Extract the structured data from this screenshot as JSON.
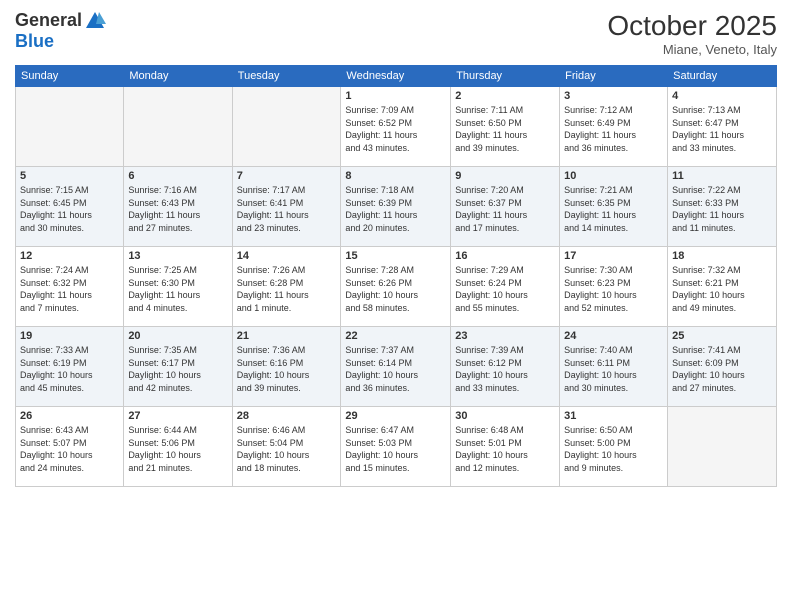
{
  "header": {
    "logo_line1": "General",
    "logo_line2": "Blue",
    "month_title": "October 2025",
    "location": "Miane, Veneto, Italy"
  },
  "days_of_week": [
    "Sunday",
    "Monday",
    "Tuesday",
    "Wednesday",
    "Thursday",
    "Friday",
    "Saturday"
  ],
  "weeks": [
    [
      {
        "day": "",
        "info": ""
      },
      {
        "day": "",
        "info": ""
      },
      {
        "day": "",
        "info": ""
      },
      {
        "day": "1",
        "info": "Sunrise: 7:09 AM\nSunset: 6:52 PM\nDaylight: 11 hours\nand 43 minutes."
      },
      {
        "day": "2",
        "info": "Sunrise: 7:11 AM\nSunset: 6:50 PM\nDaylight: 11 hours\nand 39 minutes."
      },
      {
        "day": "3",
        "info": "Sunrise: 7:12 AM\nSunset: 6:49 PM\nDaylight: 11 hours\nand 36 minutes."
      },
      {
        "day": "4",
        "info": "Sunrise: 7:13 AM\nSunset: 6:47 PM\nDaylight: 11 hours\nand 33 minutes."
      }
    ],
    [
      {
        "day": "5",
        "info": "Sunrise: 7:15 AM\nSunset: 6:45 PM\nDaylight: 11 hours\nand 30 minutes."
      },
      {
        "day": "6",
        "info": "Sunrise: 7:16 AM\nSunset: 6:43 PM\nDaylight: 11 hours\nand 27 minutes."
      },
      {
        "day": "7",
        "info": "Sunrise: 7:17 AM\nSunset: 6:41 PM\nDaylight: 11 hours\nand 23 minutes."
      },
      {
        "day": "8",
        "info": "Sunrise: 7:18 AM\nSunset: 6:39 PM\nDaylight: 11 hours\nand 20 minutes."
      },
      {
        "day": "9",
        "info": "Sunrise: 7:20 AM\nSunset: 6:37 PM\nDaylight: 11 hours\nand 17 minutes."
      },
      {
        "day": "10",
        "info": "Sunrise: 7:21 AM\nSunset: 6:35 PM\nDaylight: 11 hours\nand 14 minutes."
      },
      {
        "day": "11",
        "info": "Sunrise: 7:22 AM\nSunset: 6:33 PM\nDaylight: 11 hours\nand 11 minutes."
      }
    ],
    [
      {
        "day": "12",
        "info": "Sunrise: 7:24 AM\nSunset: 6:32 PM\nDaylight: 11 hours\nand 7 minutes."
      },
      {
        "day": "13",
        "info": "Sunrise: 7:25 AM\nSunset: 6:30 PM\nDaylight: 11 hours\nand 4 minutes."
      },
      {
        "day": "14",
        "info": "Sunrise: 7:26 AM\nSunset: 6:28 PM\nDaylight: 11 hours\nand 1 minute."
      },
      {
        "day": "15",
        "info": "Sunrise: 7:28 AM\nSunset: 6:26 PM\nDaylight: 10 hours\nand 58 minutes."
      },
      {
        "day": "16",
        "info": "Sunrise: 7:29 AM\nSunset: 6:24 PM\nDaylight: 10 hours\nand 55 minutes."
      },
      {
        "day": "17",
        "info": "Sunrise: 7:30 AM\nSunset: 6:23 PM\nDaylight: 10 hours\nand 52 minutes."
      },
      {
        "day": "18",
        "info": "Sunrise: 7:32 AM\nSunset: 6:21 PM\nDaylight: 10 hours\nand 49 minutes."
      }
    ],
    [
      {
        "day": "19",
        "info": "Sunrise: 7:33 AM\nSunset: 6:19 PM\nDaylight: 10 hours\nand 45 minutes."
      },
      {
        "day": "20",
        "info": "Sunrise: 7:35 AM\nSunset: 6:17 PM\nDaylight: 10 hours\nand 42 minutes."
      },
      {
        "day": "21",
        "info": "Sunrise: 7:36 AM\nSunset: 6:16 PM\nDaylight: 10 hours\nand 39 minutes."
      },
      {
        "day": "22",
        "info": "Sunrise: 7:37 AM\nSunset: 6:14 PM\nDaylight: 10 hours\nand 36 minutes."
      },
      {
        "day": "23",
        "info": "Sunrise: 7:39 AM\nSunset: 6:12 PM\nDaylight: 10 hours\nand 33 minutes."
      },
      {
        "day": "24",
        "info": "Sunrise: 7:40 AM\nSunset: 6:11 PM\nDaylight: 10 hours\nand 30 minutes."
      },
      {
        "day": "25",
        "info": "Sunrise: 7:41 AM\nSunset: 6:09 PM\nDaylight: 10 hours\nand 27 minutes."
      }
    ],
    [
      {
        "day": "26",
        "info": "Sunrise: 6:43 AM\nSunset: 5:07 PM\nDaylight: 10 hours\nand 24 minutes."
      },
      {
        "day": "27",
        "info": "Sunrise: 6:44 AM\nSunset: 5:06 PM\nDaylight: 10 hours\nand 21 minutes."
      },
      {
        "day": "28",
        "info": "Sunrise: 6:46 AM\nSunset: 5:04 PM\nDaylight: 10 hours\nand 18 minutes."
      },
      {
        "day": "29",
        "info": "Sunrise: 6:47 AM\nSunset: 5:03 PM\nDaylight: 10 hours\nand 15 minutes."
      },
      {
        "day": "30",
        "info": "Sunrise: 6:48 AM\nSunset: 5:01 PM\nDaylight: 10 hours\nand 12 minutes."
      },
      {
        "day": "31",
        "info": "Sunrise: 6:50 AM\nSunset: 5:00 PM\nDaylight: 10 hours\nand 9 minutes."
      },
      {
        "day": "",
        "info": ""
      }
    ]
  ]
}
